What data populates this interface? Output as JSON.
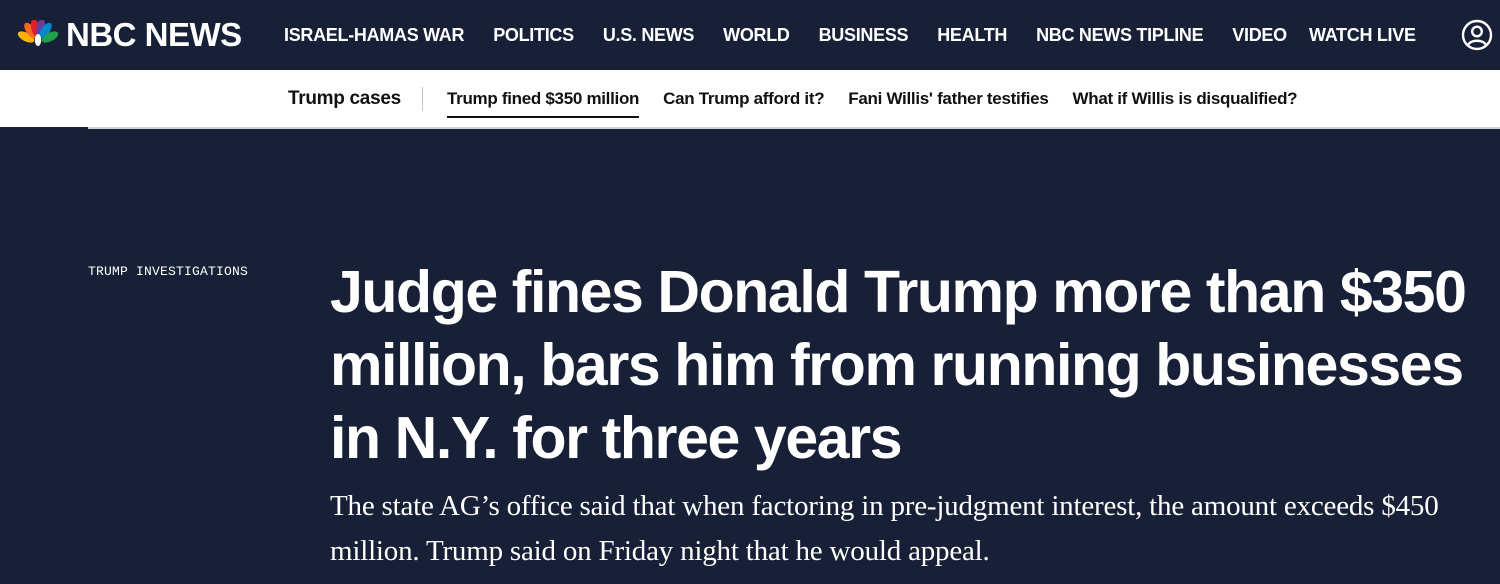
{
  "brand": {
    "name": "NBC NEWS",
    "peacock_colors": [
      "#f9b20b",
      "#f26b21",
      "#e31f26",
      "#6c3d97",
      "#0288c9",
      "#21a04a"
    ]
  },
  "topnav": {
    "items": [
      {
        "label": "ISRAEL-HAMAS WAR"
      },
      {
        "label": "POLITICS"
      },
      {
        "label": "U.S. NEWS"
      },
      {
        "label": "WORLD"
      },
      {
        "label": "BUSINESS"
      },
      {
        "label": "HEALTH"
      },
      {
        "label": "NBC NEWS TIPLINE"
      },
      {
        "label": "VIDEO"
      }
    ],
    "watch_live": "WATCH LIVE",
    "account_icon": "user-circle-icon"
  },
  "subnav": {
    "title": "Trump cases",
    "links": [
      {
        "label": "Trump fined $350 million",
        "active": true
      },
      {
        "label": "Can Trump afford it?",
        "active": false
      },
      {
        "label": "Fani Willis' father testifies",
        "active": false
      },
      {
        "label": "What if Willis is disqualified?",
        "active": false
      }
    ]
  },
  "article": {
    "label": "TRUMP INVESTIGATIONS",
    "headline": "Judge fines Donald Trump more than $350 million, bars him from running businesses in N.Y. for three years",
    "dek": "The state AG’s office said that when factoring in pre-judgment interest, the amount exceeds $450 million. Trump said on Friday night that he would appeal."
  },
  "colors": {
    "background": "#172036",
    "text": "#ffffff",
    "subnav_bg": "#ffffff"
  }
}
